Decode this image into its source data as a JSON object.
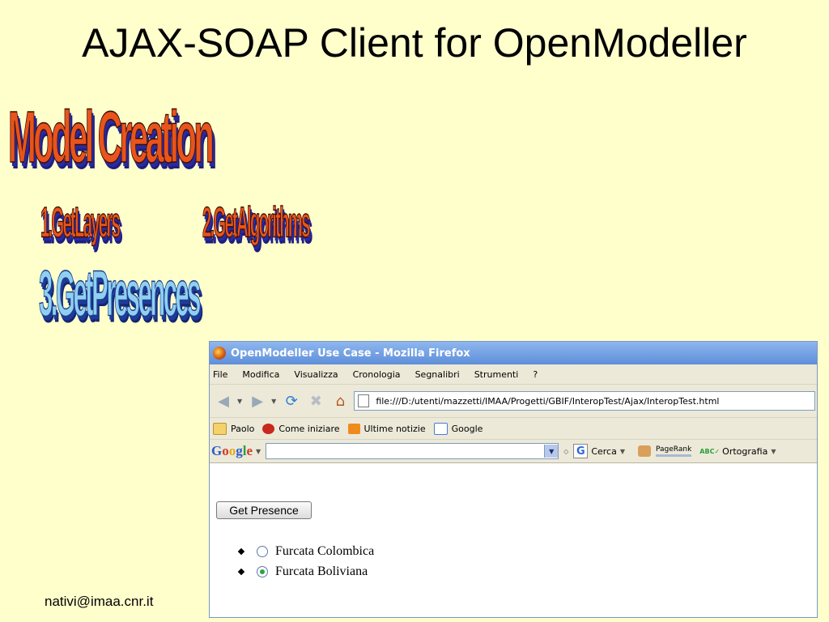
{
  "slide": {
    "title": "AJAX-SOAP Client for OpenModeller",
    "wordart": {
      "model_creation": "Model Creation",
      "get_layers": "1.GetLayers",
      "get_algorithms": "2.GetAlgorithms",
      "get_presences": "3.GetPresences"
    },
    "footer": "nativi@imaa.cnr.it"
  },
  "browser": {
    "window_title": "OpenModeller Use Case - Mozilla Firefox",
    "menu": [
      "File",
      "Modifica",
      "Visualizza",
      "Cronologia",
      "Segnalibri",
      "Strumenti",
      "?"
    ],
    "url": "file:///D:/utenti/mazzetti/IMAA/Progetti/GBIF/InteropTest/Ajax/InteropTest.html",
    "bookmarks": [
      "Paolo",
      "Come iniziare",
      "Ultime notizie",
      "Google"
    ],
    "google_toolbar": {
      "logo": "Google",
      "search_value": "",
      "cerca": "Cerca",
      "pagerank": "PageRank",
      "ortografia": "Ortografia"
    },
    "content": {
      "button_label": "Get Presence",
      "options": [
        {
          "label": "Furcata Colombica",
          "selected": false
        },
        {
          "label": "Furcata Boliviana",
          "selected": true
        }
      ]
    }
  }
}
